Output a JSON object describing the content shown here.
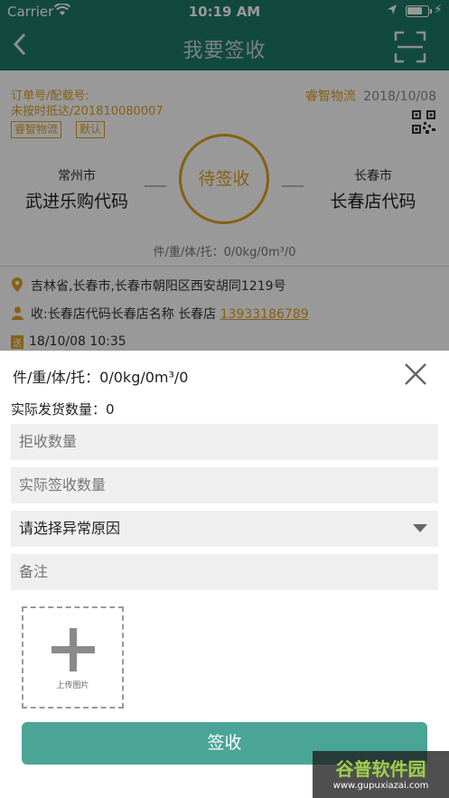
{
  "status_bar": {
    "carrier": "Carrier",
    "time": "10:19 AM"
  },
  "nav": {
    "title": "我要签收"
  },
  "order": {
    "label_line1": "订单号/配载号:",
    "label_line2": "未按时抵达/201810080007",
    "company": "睿智物流",
    "date": "2018/10/08",
    "tags": [
      "睿智物流",
      "默认"
    ]
  },
  "route": {
    "from_city": "常州市",
    "from_name": "武进乐购代码",
    "status": "待签收",
    "to_city": "长春市",
    "to_name": "长春店代码",
    "summary": "件/重/体/托：0/0kg/0m³/0"
  },
  "address": {
    "location": "吉林省,长春市,长春市朝阳区西安胡同1219号",
    "receiver_prefix": "收:长春店代码长春店名称 长春店",
    "phone": "13933186789",
    "badge": "送",
    "time": "18/10/08 10:35"
  },
  "sheet": {
    "summary": "件/重/体/托：0/0kg/0m³/0",
    "ship_qty": "实际发货数量：0",
    "reject_placeholder": "拒收数量",
    "actual_placeholder": "实际签收数量",
    "reason_select": "请选择异常原因",
    "remark_placeholder": "备注",
    "upload_label": "上传图片",
    "submit_label": "签收"
  },
  "watermark": {
    "title": "谷普软件园",
    "url": "www.gupuxiazai.com"
  },
  "colors": {
    "primary": "#1f7a68",
    "accent": "#e0a020",
    "button": "#4aa596"
  }
}
